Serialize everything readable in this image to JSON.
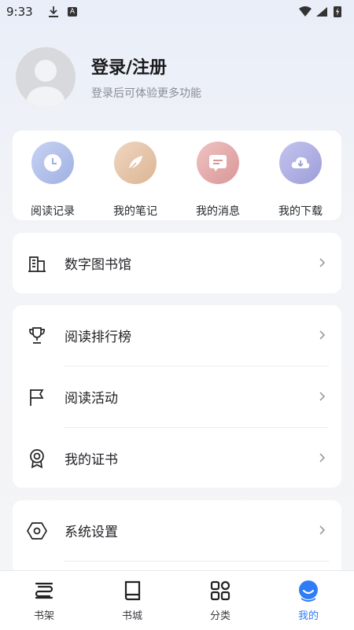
{
  "status_bar": {
    "time": "9:33",
    "a_badge": "A"
  },
  "profile": {
    "title": "登录/注册",
    "subtitle": "登录后可体验更多功能"
  },
  "quick_actions": [
    {
      "label": "阅读记录",
      "icon": "clock-icon",
      "color": "#a9b8e6"
    },
    {
      "label": "我的笔记",
      "icon": "feather-icon",
      "color": "#e4c3a6"
    },
    {
      "label": "我的消息",
      "icon": "message-icon",
      "color": "#e3a5a5"
    },
    {
      "label": "我的下载",
      "icon": "cloud-download-icon",
      "color": "#a9a9e2"
    }
  ],
  "menu": {
    "library": "数字图书馆",
    "ranking": "阅读排行榜",
    "activities": "阅读活动",
    "certificates": "我的证书",
    "settings": "系统设置"
  },
  "bottom_nav": [
    {
      "label": "书架",
      "icon": "bookshelf-icon"
    },
    {
      "label": "书城",
      "icon": "book-icon"
    },
    {
      "label": "分类",
      "icon": "grid-icon"
    },
    {
      "label": "我的",
      "icon": "profile-icon",
      "active": true
    }
  ],
  "colors": {
    "accent": "#2f7cf6",
    "text": "#1f2024",
    "muted": "#8a8d96"
  }
}
